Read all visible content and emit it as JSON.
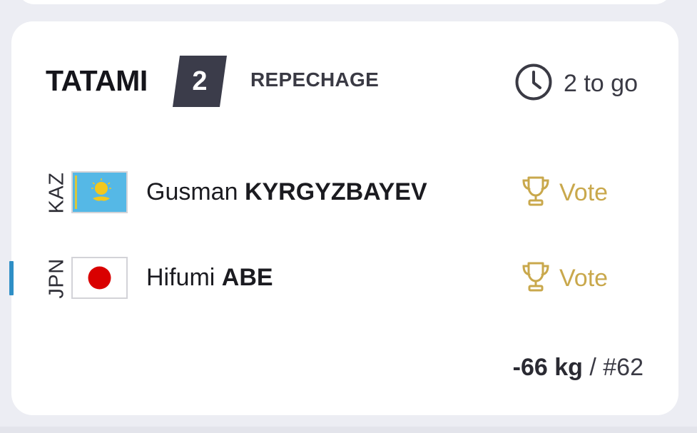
{
  "match": {
    "tatami_label": "TATAMI",
    "tatami_number": "2",
    "round": "REPECHAGE",
    "remaining": "2 to go",
    "weight_class": "-66 kg",
    "separator": " / ",
    "match_number": "#62"
  },
  "fighters": [
    {
      "country_code": "KAZ",
      "flag": "kazakhstan-flag",
      "first_name": "Gusman",
      "last_name": "KYRGYZBAYEV",
      "vote_label": "Vote",
      "vote_icon": "trophy-icon",
      "active": false
    },
    {
      "country_code": "JPN",
      "flag": "japan-flag",
      "first_name": "Hifumi",
      "last_name": "ABE",
      "vote_label": "Vote",
      "vote_icon": "trophy-icon",
      "active": true
    }
  ],
  "icons": {
    "clock": "clock-icon"
  },
  "colors": {
    "background": "#ecedf3",
    "card": "#ffffff",
    "tatami_badge": "#3b3c4a",
    "vote_gold": "#c9a84c",
    "active_marker": "#2f8fc6",
    "kaz_blue": "#55b8e6",
    "kaz_yellow": "#f2c81e",
    "jpn_red": "#d90000"
  }
}
